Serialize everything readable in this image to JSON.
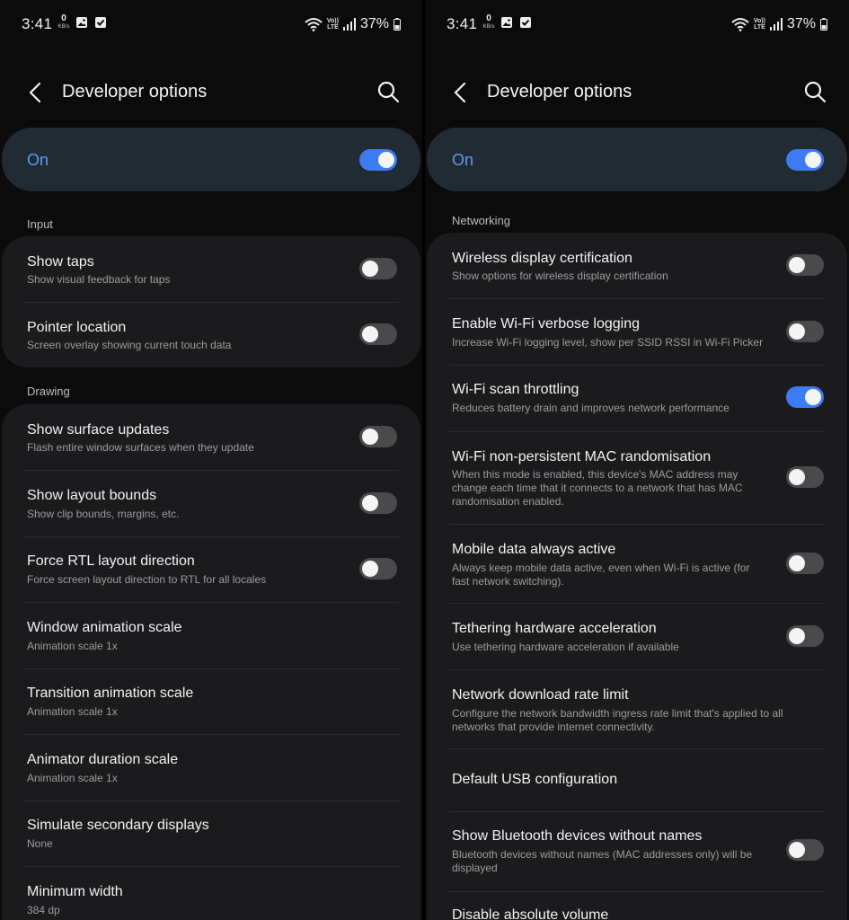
{
  "status_bar": {
    "time": "3:41",
    "net_speed_value": "0",
    "net_speed_unit": "KB/s",
    "volte_line1": "Vo))",
    "volte_line2": "LTE",
    "battery": "37%"
  },
  "app_bar": {
    "title": "Developer options"
  },
  "master_switch": {
    "label": "On",
    "enabled": true
  },
  "left_screen": {
    "sections": {
      "input": "Input",
      "drawing": "Drawing"
    },
    "input_items": [
      {
        "title": "Show taps",
        "subtitle": "Show visual feedback for taps",
        "enabled": false
      },
      {
        "title": "Pointer location",
        "subtitle": "Screen overlay showing current touch data",
        "enabled": false
      }
    ],
    "drawing_items": [
      {
        "title": "Show surface updates",
        "subtitle": "Flash entire window surfaces when they update",
        "enabled": false
      },
      {
        "title": "Show layout bounds",
        "subtitle": "Show clip bounds, margins, etc.",
        "enabled": false
      },
      {
        "title": "Force RTL layout direction",
        "subtitle": "Force screen layout direction to RTL for all locales",
        "enabled": false
      },
      {
        "title": "Window animation scale",
        "subtitle": "Animation scale 1x"
      },
      {
        "title": "Transition animation scale",
        "subtitle": "Animation scale 1x"
      },
      {
        "title": "Animator duration scale",
        "subtitle": "Animation scale 1x"
      },
      {
        "title": "Simulate secondary displays",
        "subtitle": "None"
      },
      {
        "title": "Minimum width",
        "subtitle": "384 dp"
      }
    ]
  },
  "right_screen": {
    "section": "Networking",
    "items": [
      {
        "title": "Wireless display certification",
        "subtitle": "Show options for wireless display certification",
        "enabled": false
      },
      {
        "title": "Enable Wi-Fi verbose logging",
        "subtitle": "Increase Wi-Fi logging level, show per SSID RSSI in Wi-Fi Picker",
        "enabled": false
      },
      {
        "title": "Wi-Fi scan throttling",
        "subtitle": "Reduces battery drain and improves network performance",
        "enabled": true
      },
      {
        "title": "Wi-Fi non-persistent MAC randomisation",
        "subtitle": "When this mode is enabled, this device's MAC address may change each time that it connects to a network that has MAC randomisation enabled.",
        "enabled": false
      },
      {
        "title": "Mobile data always active",
        "subtitle": "Always keep mobile data active, even when Wi-Fi is active (for fast network switching).",
        "enabled": false
      },
      {
        "title": "Tethering hardware acceleration",
        "subtitle": "Use tethering hardware acceleration if available",
        "enabled": false
      },
      {
        "title": "Network download rate limit",
        "subtitle": "Configure the network bandwidth ingress rate limit that's applied to all networks that provide internet connectivity."
      },
      {
        "title": "Default USB configuration"
      },
      {
        "title": "Show Bluetooth devices without names",
        "subtitle": "Bluetooth devices without names (MAC addresses only) will be displayed",
        "enabled": false
      },
      {
        "title": "Disable absolute volume"
      }
    ]
  },
  "colors": {
    "accent": "#3d7bf2",
    "master_label": "#5d9ef2",
    "card": "#1b1b1d",
    "master_card": "#222a33"
  }
}
